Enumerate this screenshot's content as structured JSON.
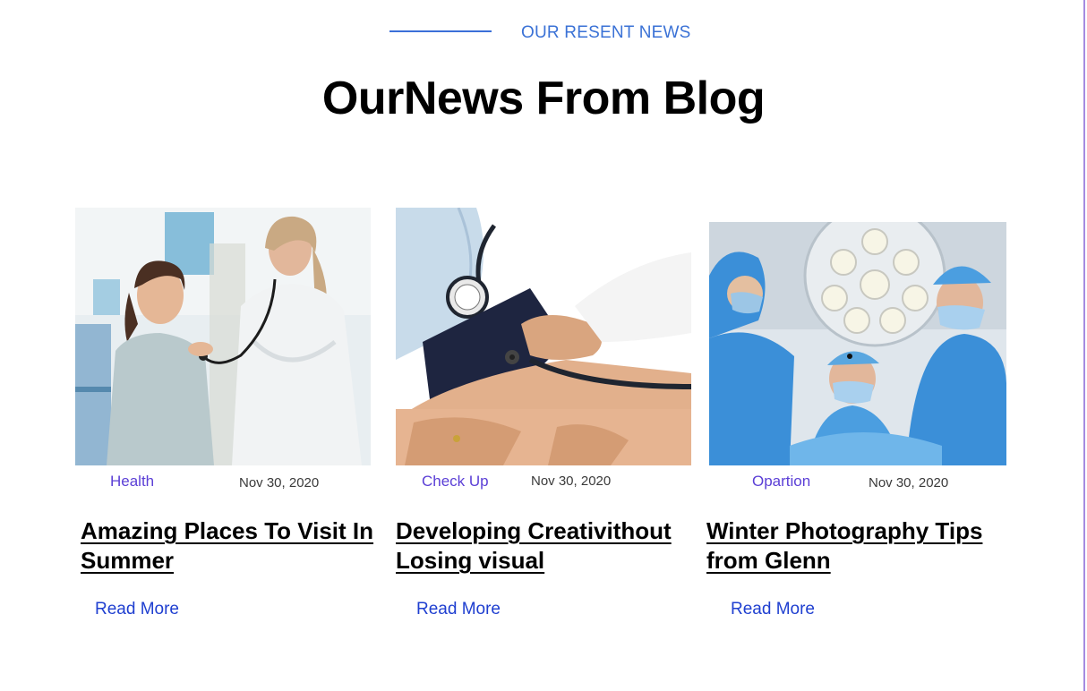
{
  "section": {
    "tagline": "OUR RESENT NEWS",
    "title": "OurNews From Blog"
  },
  "posts": [
    {
      "image_alt": "Doctor examining smiling patient with stethoscope",
      "category": "Health",
      "date": "Nov 30, 2020",
      "title": "Amazing Places To Visit In Summer",
      "read_more": "Read More"
    },
    {
      "image_alt": "Blood pressure measurement on patient arm",
      "category": "Check Up",
      "date": "Nov 30, 2020",
      "title": "Developing Creativithout Losing visual",
      "read_more": "Read More"
    },
    {
      "image_alt": "Surgeons operating under surgical lights",
      "category": "Opartion",
      "date": "Nov 30, 2020",
      "title": "Winter Photography Tips from Glenn",
      "read_more": "Read More"
    }
  ],
  "colors": {
    "accent": "#3b72d6",
    "category": "#5b3fd6",
    "link": "#1f3fd0"
  }
}
